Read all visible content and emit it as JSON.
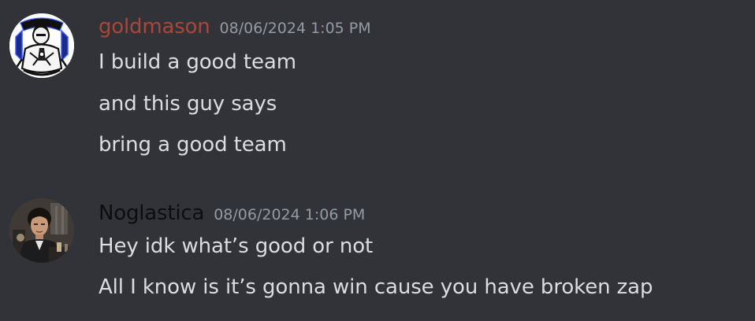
{
  "messages": [
    {
      "username": "goldmason",
      "timestamp": "08/06/2024 1:05 PM",
      "username_color": "#a8473c",
      "avatar": "bw-armored-character-avatar",
      "lines": [
        "I build a good team",
        "and this guy says",
        "bring a good team"
      ]
    },
    {
      "username": "Noglastica",
      "timestamp": "08/06/2024 1:06 PM",
      "username_color": "#0d0d0d",
      "avatar": "man-with-dark-hair-photo-avatar",
      "lines": [
        "Hey idk what’s good or not",
        "All I know is it’s gonna win cause you have broken zap"
      ]
    }
  ],
  "colors": {
    "background": "#313338",
    "text": "#dbdee1",
    "timestamp": "#949ba4"
  }
}
